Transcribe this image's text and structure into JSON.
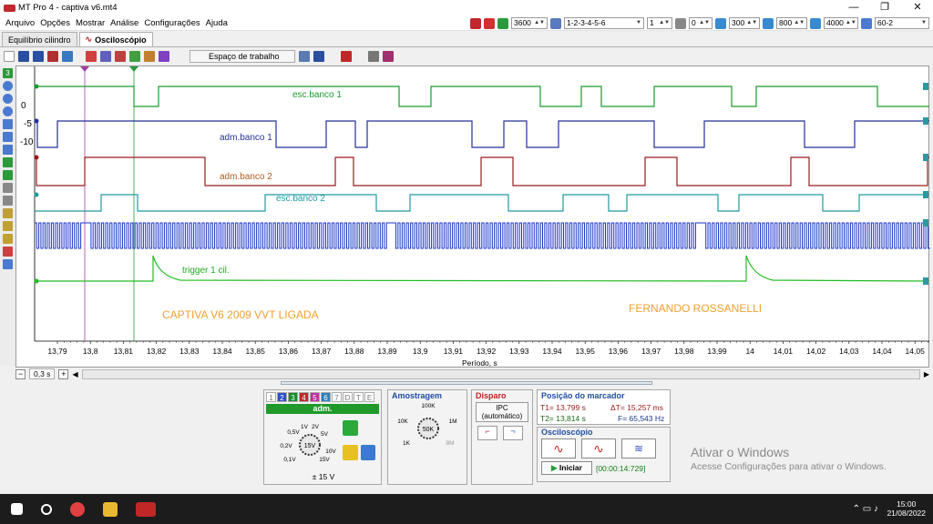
{
  "window": {
    "title": "MT Pro 4 - captiva v6.mt4"
  },
  "menu": [
    "Arquivo",
    "Opções",
    "Mostrar",
    "Análise",
    "Configurações",
    "Ajuda"
  ],
  "top_controls": {
    "time": "3600",
    "sequence": "1-2-3-4-5-6",
    "cyl": "1",
    "val1": "0",
    "val2": "300",
    "val3": "800",
    "val4": "4000",
    "preset": "60-2"
  },
  "tabs": [
    "Equilíbrio cilindro",
    "Osciloscópio"
  ],
  "toolbar": {
    "workspace": "Espaço de trabalho"
  },
  "scope": {
    "yticks": [
      "0",
      "-5",
      "-10"
    ],
    "xticks": [
      "13,79",
      "13,8",
      "13,81",
      "13,82",
      "13,83",
      "13,84",
      "13,85",
      "13,86",
      "13,87",
      "13,88",
      "13,89",
      "13,9",
      "13,91",
      "13,92",
      "13,93",
      "13,94",
      "13,95",
      "13,96",
      "13,97",
      "13,98",
      "13,99",
      "14",
      "14,01",
      "14,02",
      "14,03",
      "14,04",
      "14,05",
      "14,06"
    ],
    "xlabel": "Período, s",
    "channels": [
      {
        "name": "esc.banco 1",
        "color": "#1a9a2e"
      },
      {
        "name": "adm.banco 1",
        "color": "#24309a"
      },
      {
        "name": "adm.banco 2",
        "color": "#9a1a1a"
      },
      {
        "name": "esc.banco 2",
        "color": "#1f9aa0"
      },
      {
        "name": "trigger 1 cil.",
        "color": "#22bb22"
      }
    ],
    "annot1": "CAPTIVA V6 2009 VVT LIGADA",
    "annot2": "FERNANDO ROSSANELLI",
    "timebase": "0,3 s"
  },
  "channel_panel": {
    "numbers": [
      "1",
      "2",
      "3",
      "4",
      "5",
      "6",
      "7",
      "D",
      "T",
      "E"
    ],
    "name": "adm.",
    "range": "± 15 V",
    "knob_labels": [
      "1V",
      "2V",
      "0,5V",
      "5V",
      "0,2V",
      "10V",
      "0,1V",
      "15V"
    ],
    "knob_value": "15V"
  },
  "sampling": {
    "title": "Amostragem",
    "labels": [
      "100K",
      "10K",
      "1M",
      "1K",
      "8M"
    ],
    "value": "50K"
  },
  "trigger": {
    "title": "Disparo",
    "mode_line1": "IPC",
    "mode_line2": "(automático)"
  },
  "markers": {
    "title": "Posição do marcador",
    "t1": "T1= 13,799 s",
    "t2": "T2= 13,814 s",
    "dt": "ΔT= 15,257 ms",
    "f": "F= 65,543 Hz"
  },
  "oscilloscope_box": {
    "title": "Osciloscópio",
    "start": "Iniciar",
    "timer": "[00:00:14:729]"
  },
  "watermark": {
    "line1": "Ativar o Windows",
    "line2": "Acesse Configurações para ativar o Windows."
  },
  "taskbar": {
    "time": "15:00",
    "date": "21/08/2022"
  }
}
